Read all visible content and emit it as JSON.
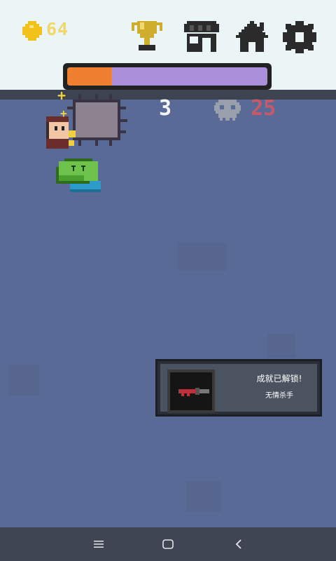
{
  "hud": {
    "coins": "64",
    "kills": "3",
    "target": "25",
    "progress": 0.22
  },
  "icons": {
    "coin": "coin-icon",
    "trophy": "trophy-icon",
    "shop": "shop-icon",
    "home": "home-icon",
    "settings": "gear-icon",
    "skull": "skull-icon"
  },
  "toast": {
    "title": "成就已解锁!",
    "achievement": "无情杀手"
  },
  "system_nav": {
    "menu": "menu-icon",
    "home": "home-circle-icon",
    "back": "back-icon"
  },
  "colors": {
    "accent": "#f08030",
    "coin": "#f0d76a",
    "target": "#c65a6a",
    "slime": "#6cc24a"
  }
}
